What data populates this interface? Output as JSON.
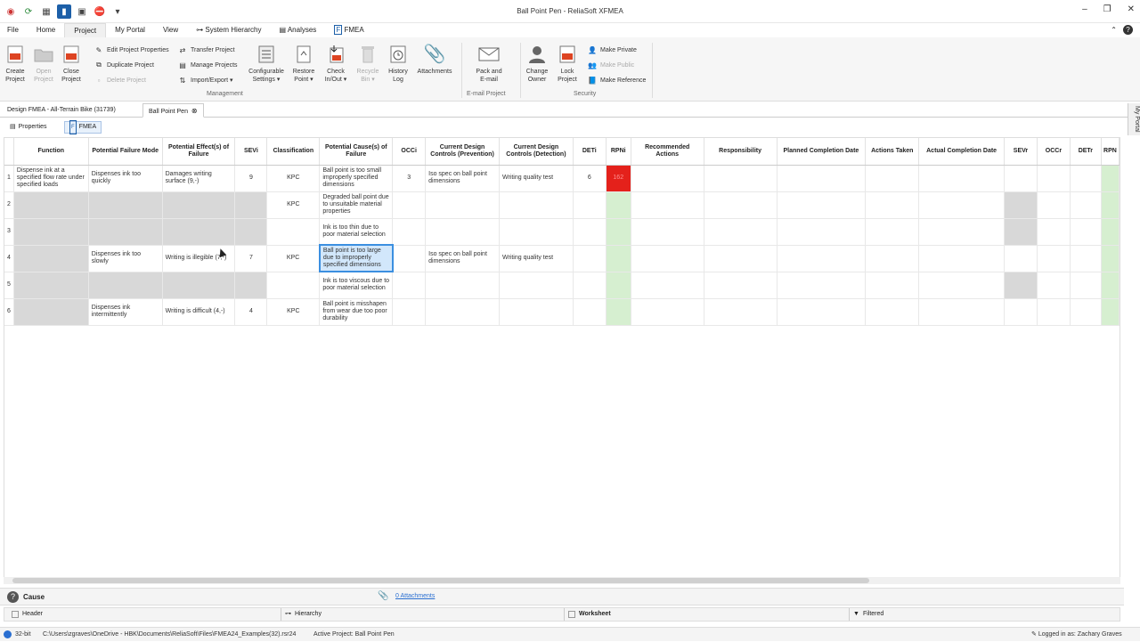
{
  "window": {
    "title": "Ball Point Pen - ReliaSoft XFMEA"
  },
  "menu": [
    "File",
    "Home",
    "Project",
    "My Portal",
    "View",
    "System Hierarchy",
    "Analyses",
    "FMEA"
  ],
  "ribbon": {
    "create_project": "Create Project",
    "open_project": "Open Project",
    "close_project": "Close Project",
    "edit_props": "Edit Project Properties",
    "duplicate": "Duplicate Project",
    "delete": "Delete Project",
    "transfer": "Transfer Project",
    "manage": "Manage Projects",
    "import_export": "Import/Export ▾",
    "config_settings": "Configurable Settings ▾",
    "restore": "Restore Point ▾",
    "check": "Check In/Out ▾",
    "recycle": "Recycle Bin ▾",
    "history": "History Log",
    "attachments": "Attachments",
    "group_management": "Management",
    "pack_email": "Pack and E-mail",
    "group_email": "E-mail Project",
    "change_owner": "Change Owner",
    "lock": "Lock Project",
    "make_private": "Make Private",
    "make_public": "Make Public",
    "make_reference": "Make Reference",
    "group_security": "Security"
  },
  "doc_tabs": [
    "Design FMEA - All-Terrain Bike (31739)",
    "Ball Point Pen"
  ],
  "sub_tabs": [
    "Properties",
    "FMEA"
  ],
  "side_portal": "My Portal",
  "table": {
    "headers": [
      "Function",
      "Potential Failure Mode",
      "Potential Effect(s) of Failure",
      "SEVi",
      "Classification",
      "Potential Cause(s) of Failure",
      "OCCi",
      "Current Design Controls (Prevention)",
      "Current Design Controls (Detection)",
      "DETi",
      "RPNi",
      "Recommended Actions",
      "Responsibility",
      "Planned Completion Date",
      "Actions Taken",
      "Actual Completion Date",
      "SEVr",
      "OCCr",
      "DETr",
      "RPN"
    ],
    "rows": [
      {
        "n": "1",
        "function": "Dispense ink at a specified flow rate under specified loads",
        "mode": "Dispenses ink too quickly",
        "effect": "Damages writing surface (9,-)",
        "sev": "9",
        "cls": "KPC",
        "cause": "Ball point is too small improperly specified dimensions",
        "occ": "3",
        "prev": "Iso spec on ball point dimensions",
        "det_ctl": "Writing quality test",
        "det": "6",
        "rpn": "162"
      },
      {
        "n": "2",
        "function": "",
        "mode": "",
        "effect": "",
        "sev": "",
        "cls": "KPC",
        "cause": "Degraded ball point due to unsuitable material properties",
        "occ": "",
        "prev": "",
        "det_ctl": "",
        "det": "",
        "rpn": ""
      },
      {
        "n": "3",
        "function": "",
        "mode": "",
        "effect": "",
        "sev": "",
        "cls": "",
        "cause": "Ink is too thin due to poor material selection",
        "occ": "",
        "prev": "",
        "det_ctl": "",
        "det": "",
        "rpn": ""
      },
      {
        "n": "4",
        "function": "",
        "mode": "Dispenses ink too slowly",
        "effect": "Writing is illegible (7,-)",
        "sev": "7",
        "cls": "KPC",
        "cause": "Ball point is too large due to improperly specified dimensions",
        "occ": "",
        "prev": "Iso spec on ball point dimensions",
        "det_ctl": "Writing quality test",
        "det": "",
        "rpn": ""
      },
      {
        "n": "5",
        "function": "",
        "mode": "",
        "effect": "",
        "sev": "",
        "cls": "",
        "cause": "Ink is too viscous due to poor material selection",
        "occ": "",
        "prev": "",
        "det_ctl": "",
        "det": "",
        "rpn": ""
      },
      {
        "n": "6",
        "function": "",
        "mode": "Dispenses ink intermittently",
        "effect": "Writing is difficult (4,-)",
        "sev": "4",
        "cls": "KPC",
        "cause": "Ball point is misshapen from wear due too poor durability",
        "occ": "",
        "prev": "",
        "det_ctl": "",
        "det": "",
        "rpn": ""
      }
    ]
  },
  "cause_bar": {
    "label": "Cause",
    "attachments": "0 Attachments"
  },
  "panels": [
    "Header",
    "Hierarchy",
    "Worksheet",
    "Filtered"
  ],
  "status": {
    "bits": "32-bit",
    "path": "C:\\Users\\zgraves\\OneDrive - HBK\\Documents\\ReliaSoft\\Files\\FMEA24_Examples(32).rsr24",
    "active": "Active Project: Ball Point Pen",
    "user": "Logged in as: Zachary Graves"
  }
}
